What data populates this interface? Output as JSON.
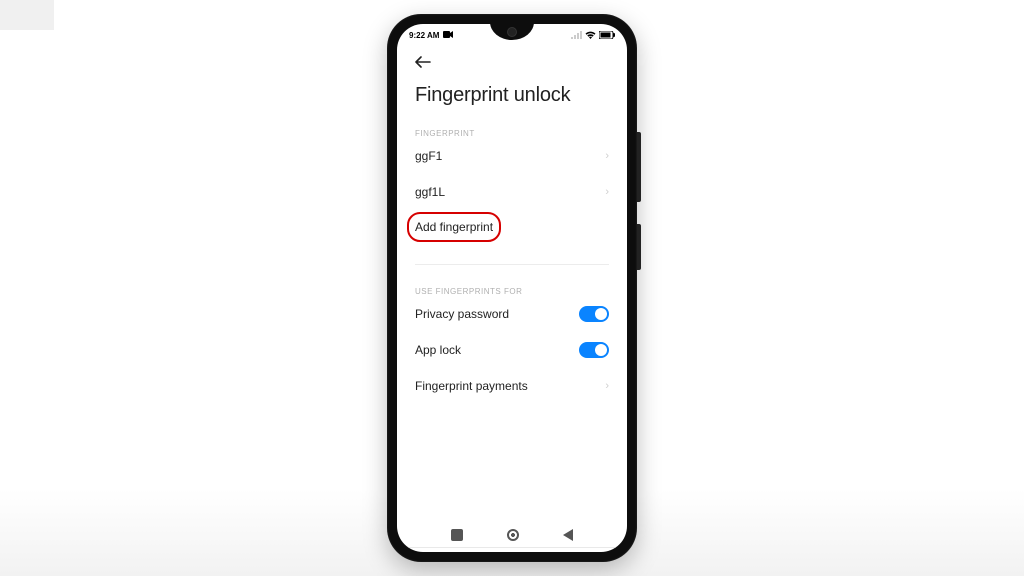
{
  "statusbar": {
    "time": "9:22 AM"
  },
  "page": {
    "title": "Fingerprint unlock",
    "section1_label": "FINGERPRINT",
    "fingerprints": [
      {
        "name": "ggF1"
      },
      {
        "name": "ggf1L"
      }
    ],
    "add_label": "Add fingerprint",
    "section2_label": "USE FINGERPRINTS FOR",
    "uses": {
      "privacy_password": {
        "label": "Privacy password",
        "enabled": true
      },
      "app_lock": {
        "label": "App lock",
        "enabled": true
      },
      "payments": {
        "label": "Fingerprint payments"
      }
    }
  }
}
